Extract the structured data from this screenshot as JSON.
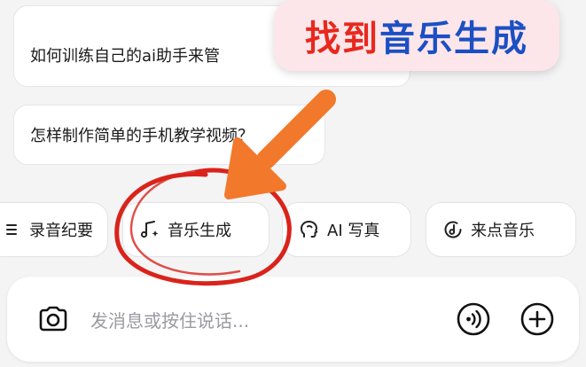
{
  "suggestions": [
    {
      "text": "如何训练自己的ai助手来管"
    },
    {
      "text": "怎样制作简单的手机教学视频？"
    }
  ],
  "chips": [
    {
      "label": "录音纪要",
      "icon": "list-icon"
    },
    {
      "label": "音乐生成",
      "icon": "music-note-icon"
    },
    {
      "label": "AI 写真",
      "icon": "portrait-icon"
    },
    {
      "label": "来点音乐",
      "icon": "music-disc-icon"
    }
  ],
  "input": {
    "placeholder": "发消息或按住说话..."
  },
  "annotation": {
    "prefix": "找到",
    "highlight": "音乐生成",
    "prefix_color": "#e8281e",
    "highlight_color": "#1b4fc4",
    "arrow_color": "#f2782b",
    "circle_color": "#d9231b"
  }
}
